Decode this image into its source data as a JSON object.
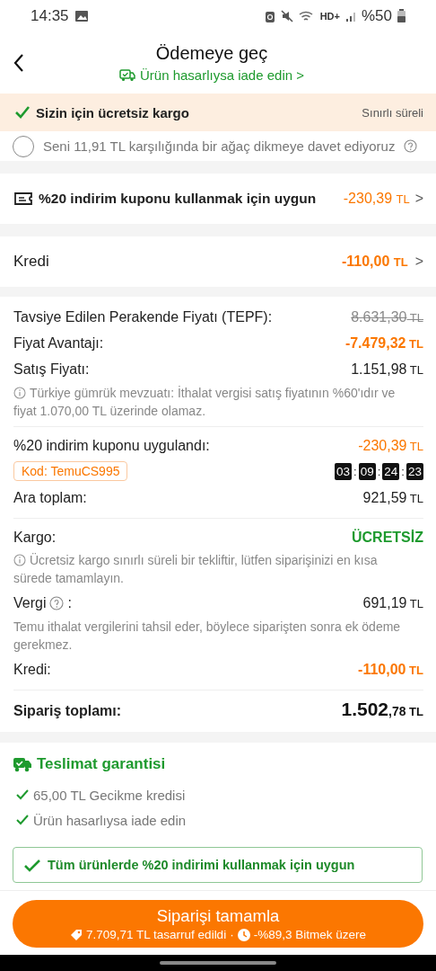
{
  "status_bar": {
    "time": "14:35",
    "network": "HD+",
    "battery": "%50"
  },
  "header": {
    "title": "Ödemeye geç",
    "subtitle": "Ürün hasarlıysa iade edin",
    "subtitle_arrow": ">"
  },
  "free_shipping": {
    "text": "Sizin için ücretsiz kargo",
    "note": "Sınırlı süreli"
  },
  "tree_offer": {
    "text": "Seni 11,91 TL karşılığında bir ağaç dikmeye davet ediyoruz",
    "checked": false
  },
  "coupon_row": {
    "text": "%20 indirim kuponu kullanmak için uygun",
    "amount": "-230,39",
    "currency": "TL",
    "arrow": ">"
  },
  "credit_row": {
    "text": "Kredi",
    "amount": "-110,00",
    "currency": "TL",
    "arrow": ">"
  },
  "summary": [
    {
      "kind": "line",
      "label": "Tavsiye Edilen Perakende Fiyatı (TEPF):",
      "amount": "8.631,30",
      "currency": "TL",
      "color": "#8a8a8a",
      "struck": true,
      "bold": false
    },
    {
      "kind": "line",
      "label": "Fiyat Avantajı:",
      "amount": "-7.479,32",
      "currency": "TL",
      "color": "#fb7701",
      "struck": false,
      "bold": true
    },
    {
      "kind": "line",
      "label": "Satış Fiyatı:",
      "amount": "1.151,98",
      "currency": "TL",
      "color": "#222222",
      "struck": false,
      "bold": false
    },
    {
      "kind": "note",
      "text": "Türkiye gümrük mevzuatı: İthalat vergisi satış fiyatının %60'ıdır ve fiyat 1.070,00 TL üzerinde olamaz.",
      "info": true
    },
    {
      "kind": "divider"
    },
    {
      "kind": "line",
      "label": "%20 indirim kuponu uygulandı:",
      "amount": "-230,39",
      "currency": "TL",
      "color": "#fb7701",
      "struck": false,
      "bold": false
    },
    {
      "kind": "code",
      "code": "Kod: TemuCS995",
      "timer": [
        {
          "kind": "digits",
          "text": "03"
        },
        {
          "kind": "sep",
          "text": ":"
        },
        {
          "kind": "digits",
          "text": "09"
        },
        {
          "kind": "sep",
          "text": ":"
        },
        {
          "kind": "digits",
          "text": "24"
        },
        {
          "kind": "sep",
          "text": ":"
        },
        {
          "kind": "digits",
          "text": "23"
        }
      ]
    },
    {
      "kind": "line",
      "label": "Ara toplam:",
      "amount": "921,59",
      "currency": "TL",
      "color": "#222222",
      "struck": false,
      "bold": false
    },
    {
      "kind": "divider"
    },
    {
      "kind": "line",
      "label": "Kargo:",
      "amount": "ÜCRETSİZ",
      "color": "#1e9a2e",
      "struck": false,
      "bold": true
    },
    {
      "kind": "note",
      "text": "Ücretsiz kargo sınırlı süreli bir tekliftir, lütfen siparişinizi en kısa sürede tamamlayın.",
      "info": true
    },
    {
      "kind": "line",
      "label": "Vergi",
      "help": true,
      "label_suffix": ":",
      "amount": "691,19",
      "currency": "TL",
      "color": "#222222",
      "struck": false,
      "bold": false
    },
    {
      "kind": "note",
      "text": "Temu ithalat vergilerini tahsil eder, böylece siparişten sonra ek ödeme gerekmez.",
      "info": false
    },
    {
      "kind": "line",
      "label": "Kredi:",
      "amount": "-110,00",
      "currency": "TL",
      "color": "#fb7701",
      "struck": false,
      "bold": true
    },
    {
      "kind": "divider"
    },
    {
      "kind": "line",
      "label": "Sipariş toplamı:",
      "amount": "1.502",
      "amount_minor": ",78",
      "currency": "TL",
      "color": "#111111",
      "struck": false,
      "bold": true
    }
  ],
  "guarantee": {
    "title": "Teslimat garantisi",
    "items": [
      "65,00 TL Gecikme kredisi",
      "Ürün hasarlıysa iade edin"
    ]
  },
  "eligible_banner": {
    "text": "Tüm ürünlerde %20 indirimi kullanmak için uygun"
  },
  "checkout": {
    "label": "Siparişi tamamla",
    "savings": "7.709,71 TL tasarruf edildi",
    "separator": "·",
    "ending": "-%89,3 Bitmek üzere"
  }
}
